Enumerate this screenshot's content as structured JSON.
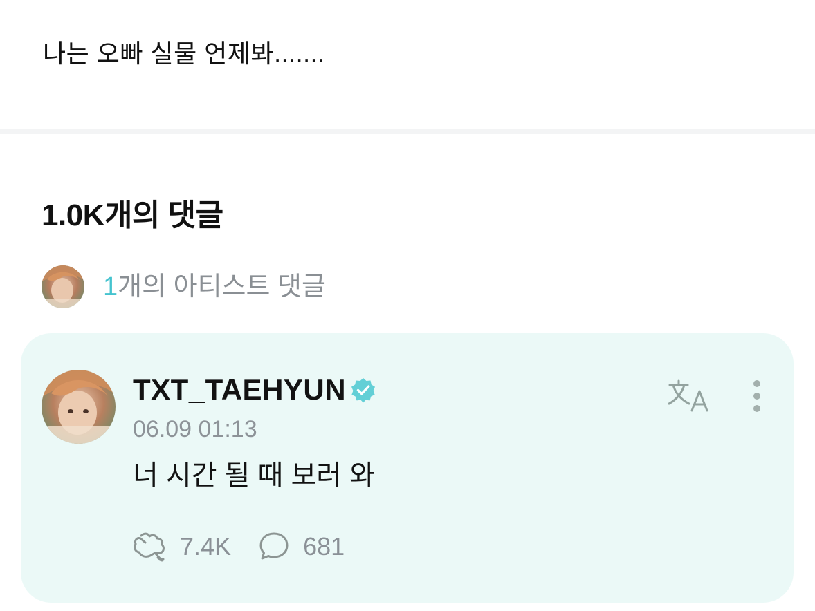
{
  "post": {
    "text": "나는 오빠 실물 언제봐......."
  },
  "comments": {
    "title": "1.0K개의 댓글",
    "artist_summary": {
      "count": "1",
      "label": "개의 아티스트 댓글"
    }
  },
  "artist_comment": {
    "author": "TXT_TAEHYUN",
    "verified": true,
    "timestamp": "06.09 01:13",
    "text": "너 시간 될 때 보러 와",
    "likes": "7.4K",
    "replies": "681"
  },
  "colors": {
    "accent": "#45c3cf",
    "card_bg": "#ebf9f7",
    "muted_text": "#8a8f94"
  },
  "icons": {
    "translate": "translate-icon",
    "more": "more-vertical-icon",
    "like": "cheer-hand-icon",
    "reply": "speech-bubble-icon",
    "verified": "verified-badge-icon"
  }
}
